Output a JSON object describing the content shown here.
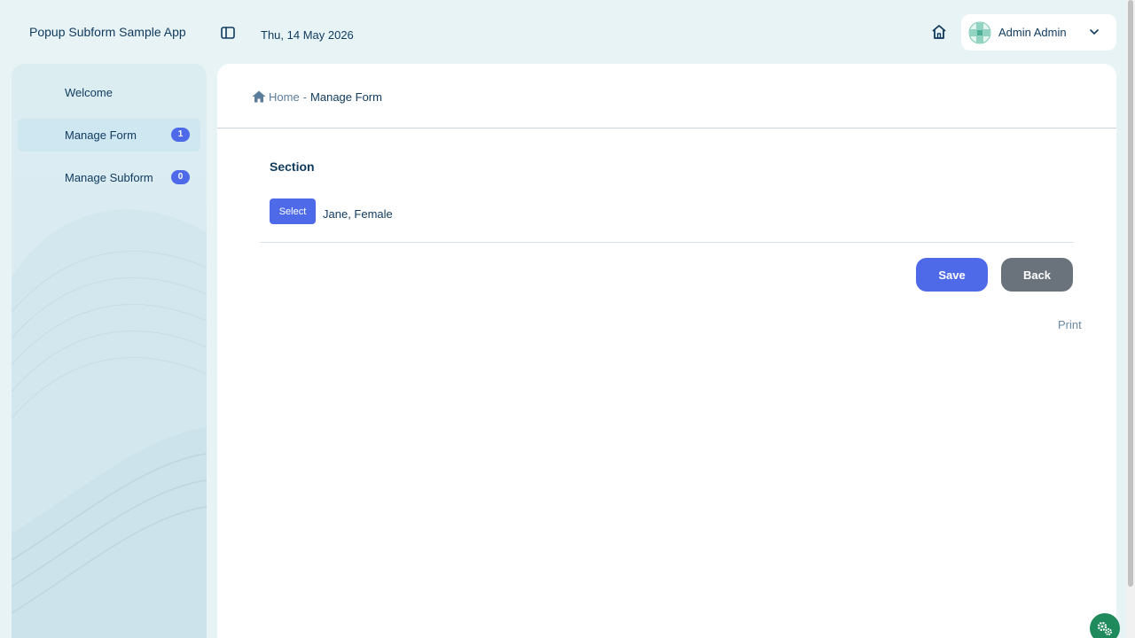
{
  "header": {
    "app_title": "Popup Subform Sample App",
    "date": "Thu, 14 May 2026",
    "user_name": "Admin Admin"
  },
  "sidebar": {
    "items": [
      {
        "label": "Welcome",
        "badge": ""
      },
      {
        "label": "Manage Form",
        "badge": "1",
        "active": true
      },
      {
        "label": "Manage Subform",
        "badge": "0"
      }
    ]
  },
  "breadcrumb": {
    "home": "Home",
    "separator": "-",
    "current": "Manage Form"
  },
  "form": {
    "section_title": "Section",
    "select_label": "Select",
    "select_value": "Jane, Female",
    "save_label": "Save",
    "back_label": "Back",
    "print_label": "Print"
  },
  "colors": {
    "accent": "#4e6ae8",
    "secondary_button": "#6a737c",
    "text_primary": "#0f3a5e",
    "fab": "#1f8a5b"
  },
  "icons": {
    "sidebar_toggle": "sidebar-toggle-icon",
    "home": "home-icon",
    "avatar": "avatar-icon",
    "dropdown": "chevron-down-icon",
    "breadcrumb_home": "home-icon",
    "fab": "gears-icon"
  }
}
